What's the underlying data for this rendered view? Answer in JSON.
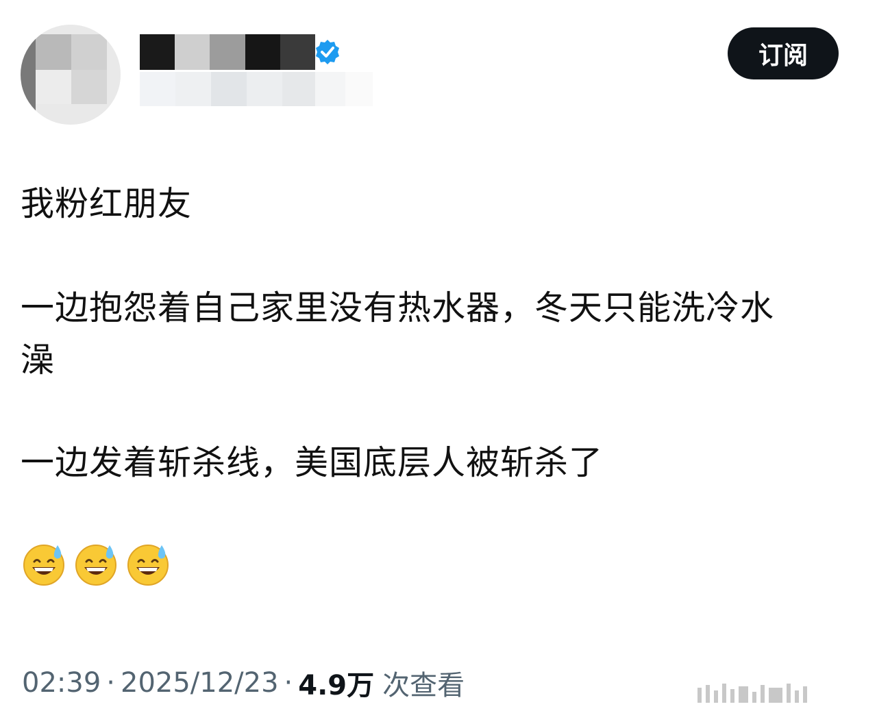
{
  "header": {
    "subscribe_label": "订阅"
  },
  "post": {
    "line1": "我粉红朋友",
    "line2a": "一边抱怨着自己家里没有热水器，冬天只能洗冷水",
    "line2b": "澡",
    "line3": "一边发着斩杀线，美国底层人被斩杀了",
    "emojis": [
      "grinning-sweat-icon",
      "grinning-sweat-icon",
      "grinning-sweat-icon"
    ]
  },
  "footer": {
    "time": "02:39",
    "date": "2025/12/23",
    "separator": "·",
    "views_count": "4.9万",
    "views_label": "次查看"
  },
  "colors": {
    "button_bg": "#0f1419",
    "verified_blue": "#1d9bf0",
    "meta_gray": "#536471"
  }
}
